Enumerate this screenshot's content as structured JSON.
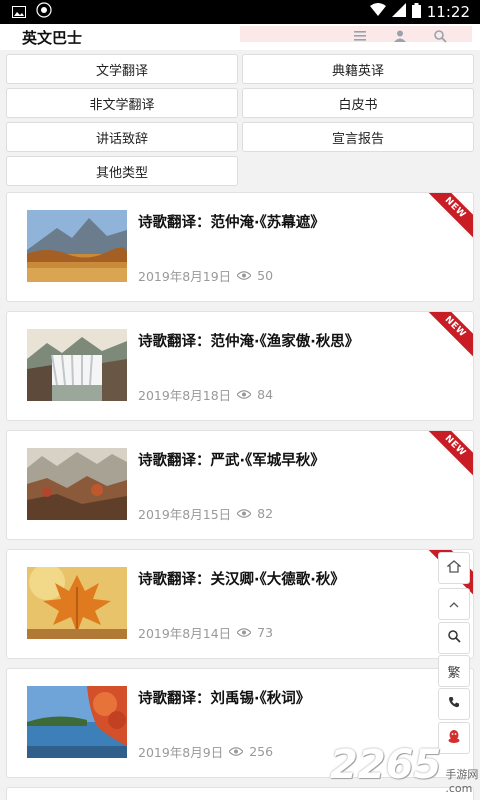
{
  "status_bar": {
    "time": "11:22"
  },
  "app": {
    "title": "英文巴士"
  },
  "categories": [
    "文学翻译",
    "典籍英译",
    "非文学翻译",
    "白皮书",
    "讲话致辞",
    "宣言报告",
    "其他类型"
  ],
  "badge": "NEW",
  "articles": [
    {
      "title": "诗歌翻译：范仲淹·《苏幕遮》",
      "date": "2019年8月19日",
      "views": "50"
    },
    {
      "title": "诗歌翻译：范仲淹·《渔家傲·秋思》",
      "date": "2019年8月18日",
      "views": "84"
    },
    {
      "title": "诗歌翻译：严武·《军城早秋》",
      "date": "2019年8月15日",
      "views": "82"
    },
    {
      "title": "诗歌翻译：关汉卿·《大德歌·秋》",
      "date": "2019年8月14日",
      "views": "73"
    },
    {
      "title": "诗歌翻译：刘禹锡·《秋词》",
      "date": "2019年8月9日",
      "views": "256"
    }
  ],
  "side_buttons": {
    "traditional": "繁"
  },
  "watermark": {
    "number": "2265",
    "suffix": ".com",
    "site": "手游网"
  },
  "colors": {
    "ribbon": "#c81d25",
    "accent_icon": "#d32f2f"
  },
  "icons": [
    "image-icon",
    "notification-icon",
    "wifi-icon",
    "signal-icon",
    "battery-icon",
    "menu-icon",
    "user-icon",
    "search-icon",
    "eye-icon",
    "home-icon",
    "arrow-up-icon",
    "phone-icon",
    "qq-icon"
  ]
}
